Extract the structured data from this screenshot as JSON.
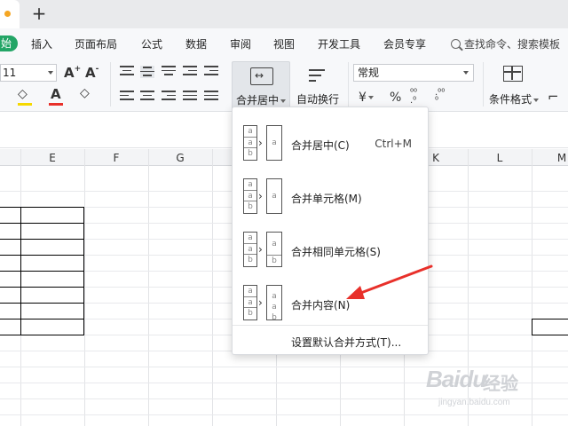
{
  "titlebar": {
    "new_tab": "+"
  },
  "ribbon_tabs": {
    "start_fragment": "始",
    "items": [
      "插入",
      "页面布局",
      "公式",
      "数据",
      "审阅",
      "视图",
      "开发工具",
      "会员专享"
    ],
    "search_text": "查找命令、搜索模板"
  },
  "ribbon": {
    "font_size": "11",
    "merge_label": "合并居中",
    "wrap_label": "自动换行",
    "number_format": "常规",
    "currency_symbol": "¥",
    "percent_symbol": "%",
    "cond_format_label": "条件格式"
  },
  "sheet": {
    "columns": [
      "E",
      "F",
      "G",
      "K",
      "L",
      "M"
    ]
  },
  "merge_menu": {
    "items": [
      {
        "label": "合并居中(C)",
        "shortcut": "Ctrl+M"
      },
      {
        "label": "合并单元格(M)",
        "shortcut": ""
      },
      {
        "label": "合并相同单元格(S)",
        "shortcut": ""
      },
      {
        "label": "合并内容(N)",
        "shortcut": ""
      }
    ],
    "footer": "设置默认合并方式(T)..."
  },
  "annotation": {
    "arrow_color": "#e8302a"
  },
  "watermark": {
    "logo_text": "Baidu",
    "logo_suffix": "经验",
    "url": "jingyan.baidu.com"
  },
  "colors": {
    "brand_green": "#23a566",
    "highlight_yellow": "#f5d800",
    "font_red": "#e8302a"
  }
}
